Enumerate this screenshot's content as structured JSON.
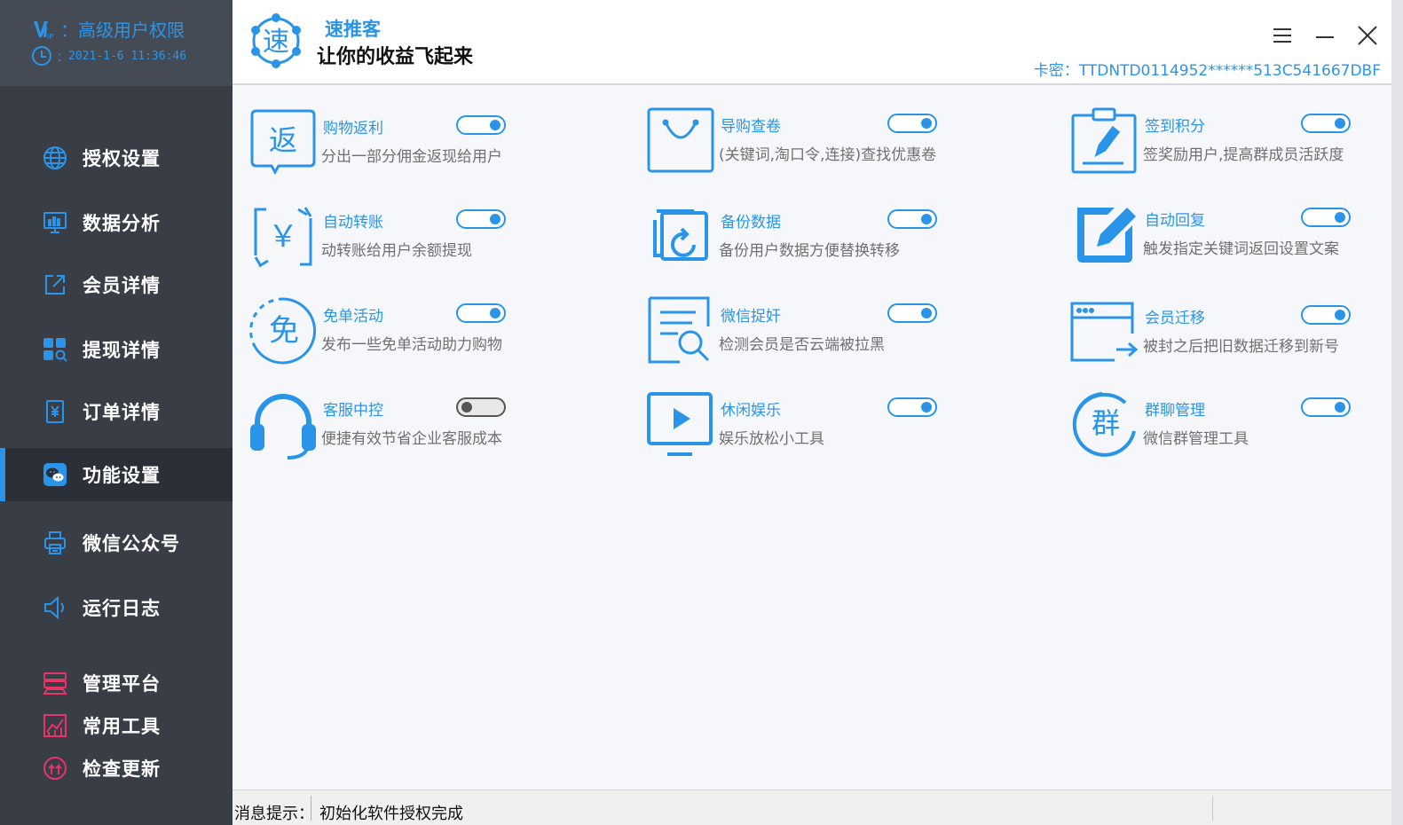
{
  "vip": {
    "label": "：高级用户权限",
    "time_prefix": "：",
    "time": "2021-1-6 11:36:46"
  },
  "nav": {
    "items": [
      {
        "label": "授权设置",
        "icon": "globe-icon"
      },
      {
        "label": "数据分析",
        "icon": "monitor-chart-icon"
      },
      {
        "label": "会员详情",
        "icon": "external-link-icon"
      },
      {
        "label": "提现详情",
        "icon": "grid-search-icon"
      },
      {
        "label": "订单详情",
        "icon": "receipt-icon"
      },
      {
        "label": "功能设置",
        "icon": "wechat-icon",
        "active": true
      },
      {
        "label": "微信公众号",
        "icon": "printer-icon"
      },
      {
        "label": "运行日志",
        "icon": "speaker-icon"
      }
    ],
    "extra": [
      {
        "label": "管理平台",
        "icon": "server-icon"
      },
      {
        "label": "常用工具",
        "icon": "chart-icon"
      },
      {
        "label": "检查更新",
        "icon": "upload-circle-icon"
      }
    ]
  },
  "header": {
    "logo_char": "速",
    "app_name": "速推客",
    "slogan": "让你的收益飞起来",
    "card_code": "卡密：TTDNTD0114952******513C541667DBF"
  },
  "features": [
    {
      "title": "购物返利",
      "desc": "分出一部分佣金返现给用户",
      "enabled": true
    },
    {
      "title": "导购查卷",
      "desc": "(关键词,淘口令,连接)查找优惠卷",
      "enabled": true
    },
    {
      "title": "签到积分",
      "desc": "签奖励用户,提高群成员活跃度",
      "enabled": true
    },
    {
      "title": "自动转账",
      "desc": "动转账给用户余额提现",
      "enabled": true
    },
    {
      "title": "备份数据",
      "desc": "备份用户数据方便替换转移",
      "enabled": true
    },
    {
      "title": "自动回复",
      "desc": "触发指定关键词返回设置文案",
      "enabled": true
    },
    {
      "title": "免单活动",
      "desc": "发布一些免单活动助力购物",
      "enabled": true
    },
    {
      "title": "微信捉奸",
      "desc": "检测会员是否云端被拉黑",
      "enabled": true
    },
    {
      "title": "会员迁移",
      "desc": "被封之后把旧数据迁移到新号",
      "enabled": true
    },
    {
      "title": "客服中控",
      "desc": "便捷有效节省企业客服成本",
      "enabled": false
    },
    {
      "title": "休闲娱乐",
      "desc": "娱乐放松小工具",
      "enabled": true
    },
    {
      "title": "群聊管理",
      "desc": "微信群管理工具",
      "enabled": true
    }
  ],
  "feature_icon_chars": {
    "rebate": "返",
    "transfer": "￥",
    "free": "免",
    "group": "群"
  },
  "status": {
    "label": "消息提示：",
    "message": "初始化软件授权完成"
  },
  "colors": {
    "accent": "#2a95e8",
    "sidebar": "#383d46",
    "sidebar_active": "#2b3038",
    "management": "#e8336a"
  }
}
